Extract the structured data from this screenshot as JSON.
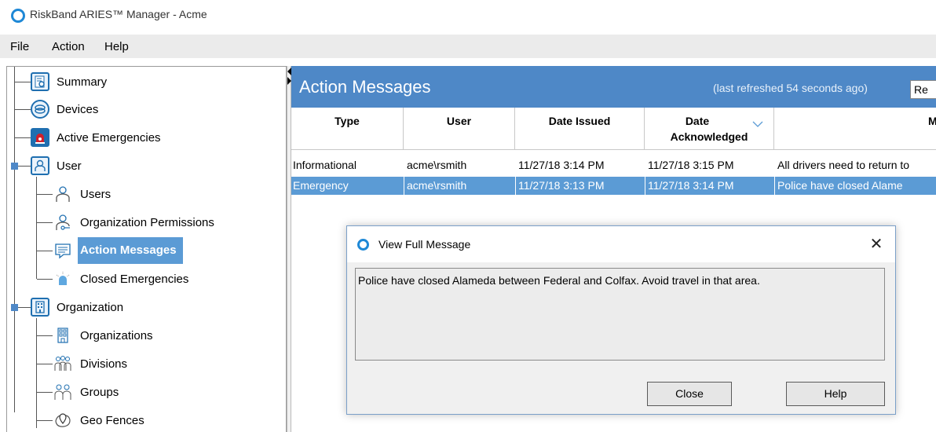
{
  "window": {
    "title": "RiskBand ARIES™ Manager - Acme"
  },
  "menu": [
    "File",
    "Action",
    "Help"
  ],
  "tree": {
    "items": [
      {
        "label": "Summary",
        "icon": "summary-icon"
      },
      {
        "label": "Devices",
        "icon": "devices-icon"
      },
      {
        "label": "Active Emergencies",
        "icon": "siren-icon"
      },
      {
        "label": "User",
        "icon": "user-icon"
      },
      {
        "label": "Users",
        "icon": "user-icon"
      },
      {
        "label": "Organization Permissions",
        "icon": "user-key-icon"
      },
      {
        "label": "Action Messages",
        "icon": "message-icon",
        "selected": true
      },
      {
        "label": "Closed Emergencies",
        "icon": "siren-off-icon"
      },
      {
        "label": "Organization",
        "icon": "building-icon"
      },
      {
        "label": "Organizations",
        "icon": "building-icon"
      },
      {
        "label": "Divisions",
        "icon": "divisions-icon"
      },
      {
        "label": "Groups",
        "icon": "groups-icon"
      },
      {
        "label": "Geo Fences",
        "icon": "geofence-icon"
      }
    ]
  },
  "main": {
    "title": "Action Messages",
    "refresh_text": "(last refreshed 54 seconds ago)",
    "refresh_button": "Re",
    "columns": [
      "Type",
      "User",
      "Date Issued",
      "Date",
      "Acknowledged",
      "M"
    ],
    "rows": [
      [
        "Informational",
        "acme\\rsmith",
        "11/27/18 3:14 PM",
        "11/27/18 3:15 PM",
        "All drivers need to return to"
      ],
      [
        "Emergency",
        "acme\\rsmith",
        "11/27/18 3:13 PM",
        "11/27/18 3:14 PM",
        "Police have closed Alame"
      ]
    ]
  },
  "dialog": {
    "title": "View Full Message",
    "close_glyph": "✕",
    "message": "Police have closed Alameda between Federal and Colfax. Avoid travel in that area.",
    "close_label": "Close",
    "help_label": "Help"
  },
  "colors": {
    "accent": "#4e88c7",
    "selection": "#5b9bd5"
  }
}
